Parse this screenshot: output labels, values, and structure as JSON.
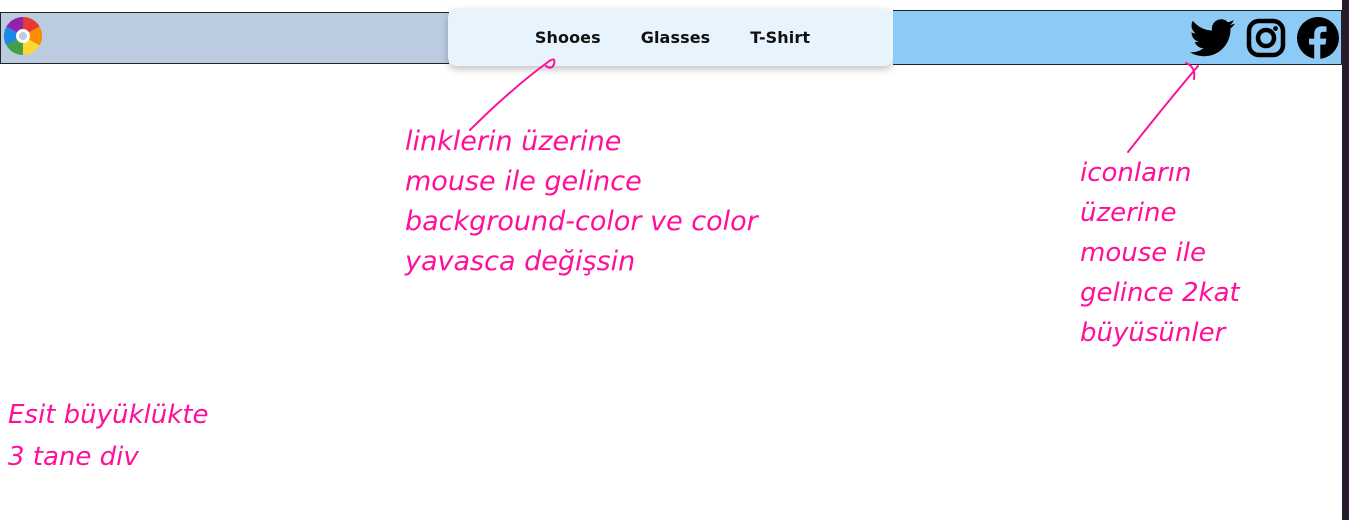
{
  "header": {
    "logo_icon": "multicolor-swirl-logo-icon",
    "nav_links": [
      {
        "label": "Shooes"
      },
      {
        "label": "Glasses"
      },
      {
        "label": "T-Shirt"
      }
    ],
    "social_icons": [
      {
        "icon": "twitter-icon"
      },
      {
        "icon": "instagram-icon"
      },
      {
        "icon": "facebook-icon"
      }
    ],
    "colors": {
      "left_panel": "#bccce0",
      "center_panel": "#e8f4fd",
      "right_panel": "#8ecaf6",
      "annotation_ink": "#ff0f9a"
    }
  },
  "annotations": {
    "links_note": [
      "linklerin üzerine",
      "mouse ile gelince",
      "background-color ve color",
      "yavasca değişsin"
    ],
    "icons_note": [
      "iconların",
      "üzerine",
      "mouse ile",
      "gelince 2kat",
      "büyüsünler"
    ],
    "divs_note": [
      "Esit büyüklükte",
      "3 tane div"
    ]
  }
}
